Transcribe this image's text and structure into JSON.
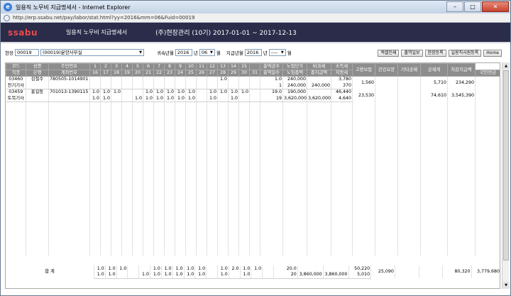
{
  "window": {
    "title": "일용직 노무비 지급명세서 - Internet Explorer",
    "url": "http://erp.ssabu.net/pay/labor/stat.html?yy=2016&mm=06&Fuid=00019",
    "min": "–",
    "max": "□",
    "close": "✕"
  },
  "header": {
    "logo": "ssabu",
    "doc_title": "일용직 노무비 지급명세서",
    "site_info": "(주)현장관리 (10기) 2017-01-01 ~ 2017-12-13"
  },
  "filter": {
    "site_label": "현장",
    "site_code": "00019",
    "site_name": "(00019)분양사무실",
    "belong_label": "귀속년월",
    "belong_year": "2016",
    "year_unit": "년",
    "belong_month": "06",
    "month_unit": "월",
    "pay_label": "지급년월",
    "pay_year": "2016",
    "pay_month": "----"
  },
  "buttons": [
    "엑셀인쇄",
    "출역일보",
    "현장등록",
    "일용직사원등록",
    "Home"
  ],
  "headers": {
    "row1": [
      "코드",
      "성명",
      "주민번호",
      "1",
      "2",
      "3",
      "4",
      "5",
      "6",
      "7",
      "8",
      "9",
      "10",
      "11",
      "12",
      "13",
      "14",
      "15",
      "출역공수",
      "노임단가",
      "비과세",
      "소득세",
      "고용보험",
      "건강요양",
      "기타공제",
      "공제계",
      "차감지급액"
    ],
    "row2": [
      "직종",
      "은행",
      "계좌번호",
      "16",
      "17",
      "18",
      "19",
      "20",
      "21",
      "22",
      "23",
      "24",
      "25",
      "26",
      "27",
      "28",
      "29",
      "30",
      "31",
      "출역일수",
      "노임총액",
      "총지급액",
      "지방세",
      "국민연금"
    ]
  },
  "workers": [
    {
      "code": "03460",
      "name": "김철수",
      "resident_no": "780505-1014901",
      "job": "전기기사",
      "bank": "",
      "account": "",
      "days1": [
        "",
        "",
        "",
        "",
        "",
        "",
        "",
        "",
        "",
        "",
        "",
        "",
        "1.0",
        "",
        ""
      ],
      "days2": [
        "",
        "",
        "",
        "",
        "",
        "",
        "",
        "",
        "",
        "",
        "",
        "",
        "",
        "",
        "",
        ""
      ],
      "work_hours": "1.0",
      "work_days": "1",
      "unit_price": "240,000",
      "wage_total": "240,000",
      "non_tax": "",
      "total_pay": "240,000",
      "income_tax": "3,780",
      "local_tax": "370",
      "employ_ins": "1,560",
      "health_ins": "",
      "pension": "",
      "other_ded": "",
      "ded_total": "5,710",
      "net_pay": "234,290"
    },
    {
      "code": "03459",
      "name": "홍길동",
      "resident_no": "701013-1390115",
      "job": "토목기사",
      "bank": "",
      "account": "",
      "days1": [
        "1.0",
        "1.0",
        "1.0",
        "",
        "",
        "1.0",
        "1.0",
        "1.0",
        "1.0",
        "1.0",
        "",
        "1.0",
        "1.0",
        "1.0",
        "1.0"
      ],
      "days2": [
        "1.0",
        "1.0",
        "",
        "",
        "1.0",
        "1.0",
        "1.0",
        "1.0",
        "1.0",
        "1.0",
        "",
        "1.0",
        "",
        "1.0",
        "",
        ""
      ],
      "work_hours": "19.0",
      "work_days": "19",
      "unit_price": "190,000",
      "wage_total": "3,620,000",
      "non_tax": "",
      "total_pay": "3,620,000",
      "income_tax": "46,440",
      "local_tax": "4,640",
      "employ_ins": "23,530",
      "health_ins": "",
      "pension": "",
      "other_ded": "",
      "ded_total": "74,610",
      "net_pay": "3,545,390"
    }
  ],
  "total": {
    "label": "합 계",
    "days1": [
      "1.0",
      "1.0",
      "1.0",
      "",
      "",
      "1.0",
      "1.0",
      "1.0",
      "1.0",
      "1.0",
      "",
      "1.0",
      "2.0",
      "1.0",
      "1.0"
    ],
    "days2": [
      "1.0",
      "1.0",
      "",
      "",
      "1.0",
      "1.0",
      "1.0",
      "1.0",
      "1.0",
      "1.0",
      "",
      "1.0",
      "",
      "1.0",
      "",
      ""
    ],
    "work_hours": "20.0",
    "work_days": "20",
    "unit_price": "",
    "wage_total": "3,860,000",
    "total_pay": "3,860,000",
    "income_tax": "50,220",
    "local_tax": "5,010",
    "employ_ins": "25,090",
    "ded_total": "80,320",
    "net_pay": "3,779,680"
  }
}
